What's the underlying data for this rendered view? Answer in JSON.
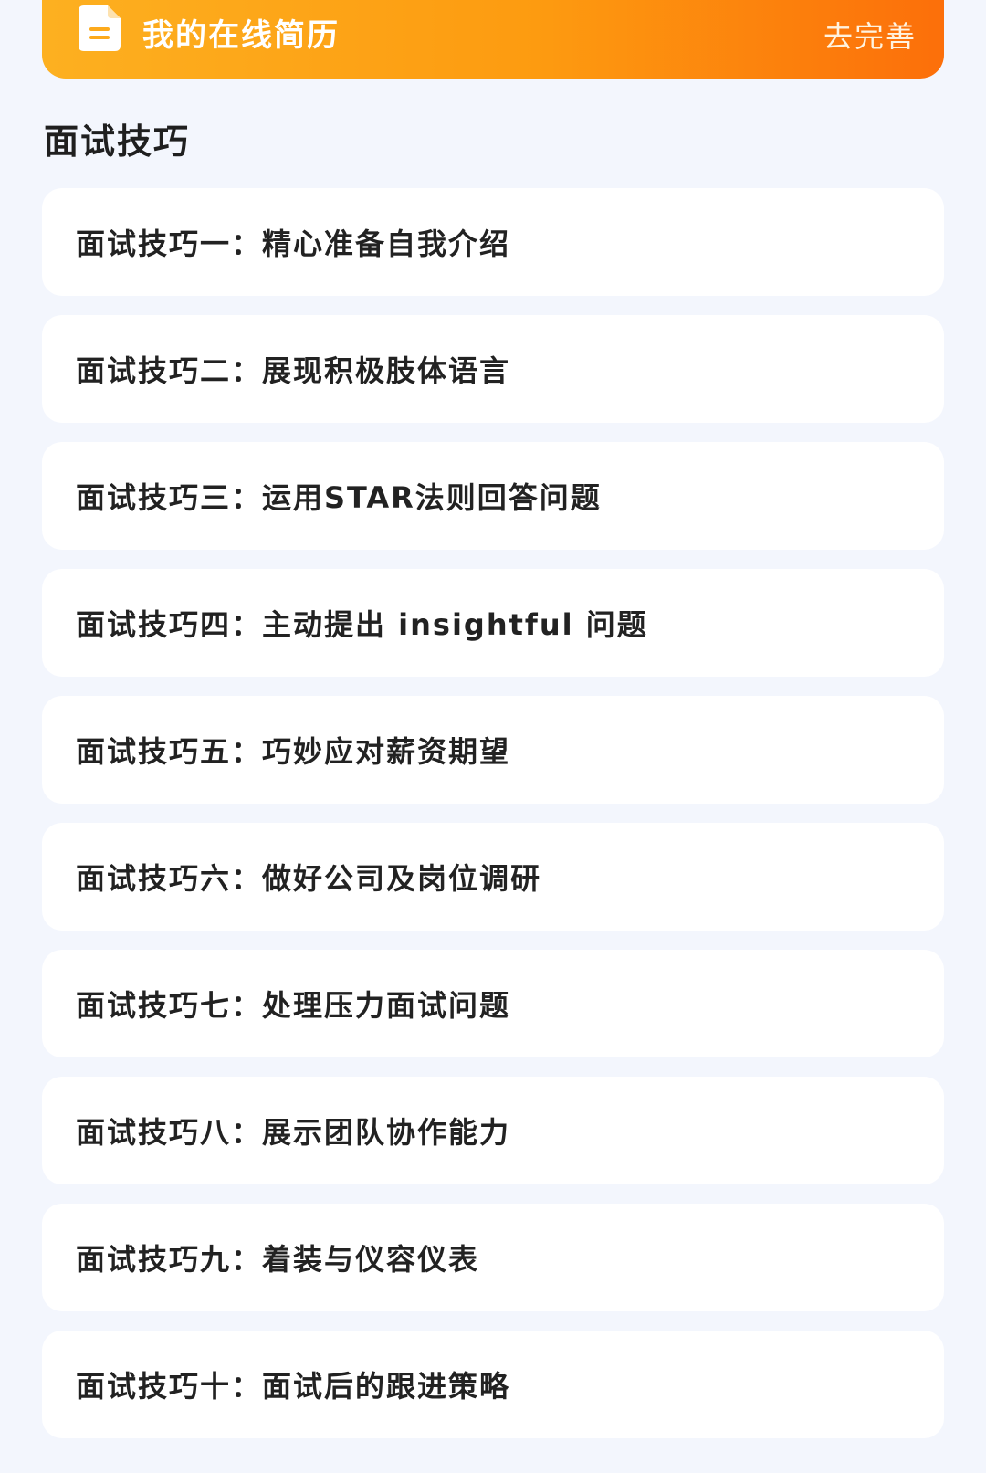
{
  "banner": {
    "title": "我的在线简历",
    "action": "去完善"
  },
  "section": {
    "title": "面试技巧"
  },
  "tips": [
    {
      "label": "面试技巧一：精心准备自我介绍"
    },
    {
      "label": "面试技巧二：展现积极肢体语言"
    },
    {
      "label": "面试技巧三：运用STAR法则回答问题"
    },
    {
      "label": "面试技巧四：主动提出 insightful 问题"
    },
    {
      "label": "面试技巧五：巧妙应对薪资期望"
    },
    {
      "label": "面试技巧六：做好公司及岗位调研"
    },
    {
      "label": "面试技巧七：处理压力面试问题"
    },
    {
      "label": "面试技巧八：展示团队协作能力"
    },
    {
      "label": "面试技巧九：着装与仪容仪表"
    },
    {
      "label": "面试技巧十：面试后的跟进策略"
    }
  ],
  "colors": {
    "banner_start": "#fdb020",
    "banner_end": "#fc6f0a",
    "page_background": "#f3f6fd",
    "card_background": "#ffffff"
  },
  "icons": {
    "banner_icon": "document-icon"
  }
}
